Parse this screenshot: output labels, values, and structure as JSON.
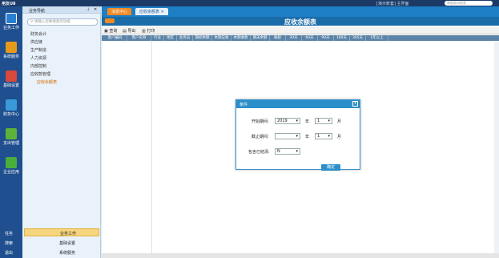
{
  "title_bar": {
    "app": "用友U8",
    "right": "[演示账套] 主界面",
    "search_placeholder": "单据条码搜索"
  },
  "left_nav": {
    "items": [
      {
        "label": "业务工作",
        "color": "#2a7fd0"
      },
      {
        "label": "系统服务",
        "color": "#e69a1c"
      },
      {
        "label": "基础设置",
        "color": "#d9483b"
      },
      {
        "label": "财务中心",
        "color": "#3a9ad9"
      },
      {
        "label": "支出管理",
        "color": "#5db33a"
      },
      {
        "label": "企业应用",
        "color": "#4aae3c"
      }
    ],
    "bottom": [
      "任务",
      "搜索",
      "退出"
    ]
  },
  "tree": {
    "header": "业务导航",
    "search_placeholder": "请输入您要搜索的功能",
    "items": [
      "财务会计",
      "供应链",
      "生产制造",
      "人力资源",
      "内部控制",
      "应收款管理",
      "应收余额表"
    ],
    "bottom": [
      "业务工作",
      "基础设置",
      "系统服务"
    ]
  },
  "tabs": [
    "消息中心",
    "应收余额表"
  ],
  "toolbar": [
    "查询",
    "导出",
    "打印"
  ],
  "report": {
    "title": "应收余额表",
    "columns": [
      "客户编码",
      "客户名称",
      "行业",
      "地区",
      "业务员",
      "期初余额",
      "本期应收",
      "本期收款",
      "期末余额",
      "账龄",
      "30天",
      "60天",
      "90天",
      "180天",
      "365天",
      "1年以上"
    ]
  },
  "modal": {
    "title": "条件",
    "start_label": "开始期间:",
    "start_year": "2019",
    "start_month": "1",
    "year_unit": "年",
    "month_unit": "月",
    "end_label": "截止期间:",
    "end_year": "",
    "end_month": "1",
    "include_label": "包含已结清:",
    "include_value": "N",
    "ok": "确定"
  }
}
